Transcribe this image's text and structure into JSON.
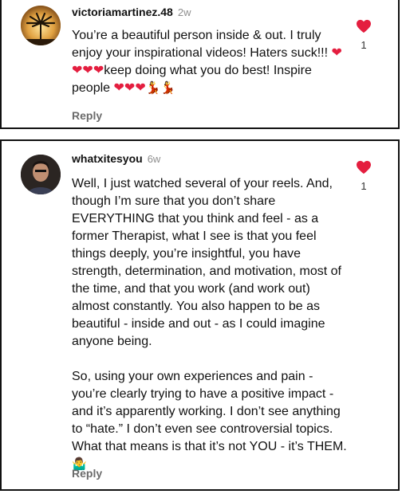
{
  "comments": [
    {
      "username": "victoriamartinez.48",
      "time": "2w",
      "text_parts": [
        "You’re a beautiful person inside & out. I truly enjoy your inspirational videos! Haters suck!!! ",
        "❤❤❤❤",
        "keep doing what you do best!  Inspire people ",
        "❤❤❤",
        "💃💃"
      ],
      "reply_label": "Reply",
      "like_count": "1"
    },
    {
      "username": "whatxitesyou",
      "time": "6w",
      "paragraph1": "Well, I just watched several of your reels. And, though I’m sure that you don’t share EVERYTHING that you think and feel - as a former Therapist, what I see is that you feel things deeply, you’re insightful, you have strength, determination, and motivation, most of the time, and that you work (and work out) almost constantly.  You also happen to be as beautiful - inside and out - as I could imagine anyone being.",
      "paragraph2": "So, using your own experiences and pain - you’re clearly trying to have a positive impact - and it’s apparently working.  I don’t see anything to “hate.” I don’t even see controversial topics.  What that means is that it’s not YOU - it’s THEM. ",
      "paragraph2_emoji": "🤷‍♂️",
      "reply_label": "Reply",
      "like_count": "1"
    }
  ],
  "colors": {
    "heart": "#e41e3f",
    "muted": "#8e8e8e"
  },
  "icons": {
    "like": "heart-icon"
  }
}
